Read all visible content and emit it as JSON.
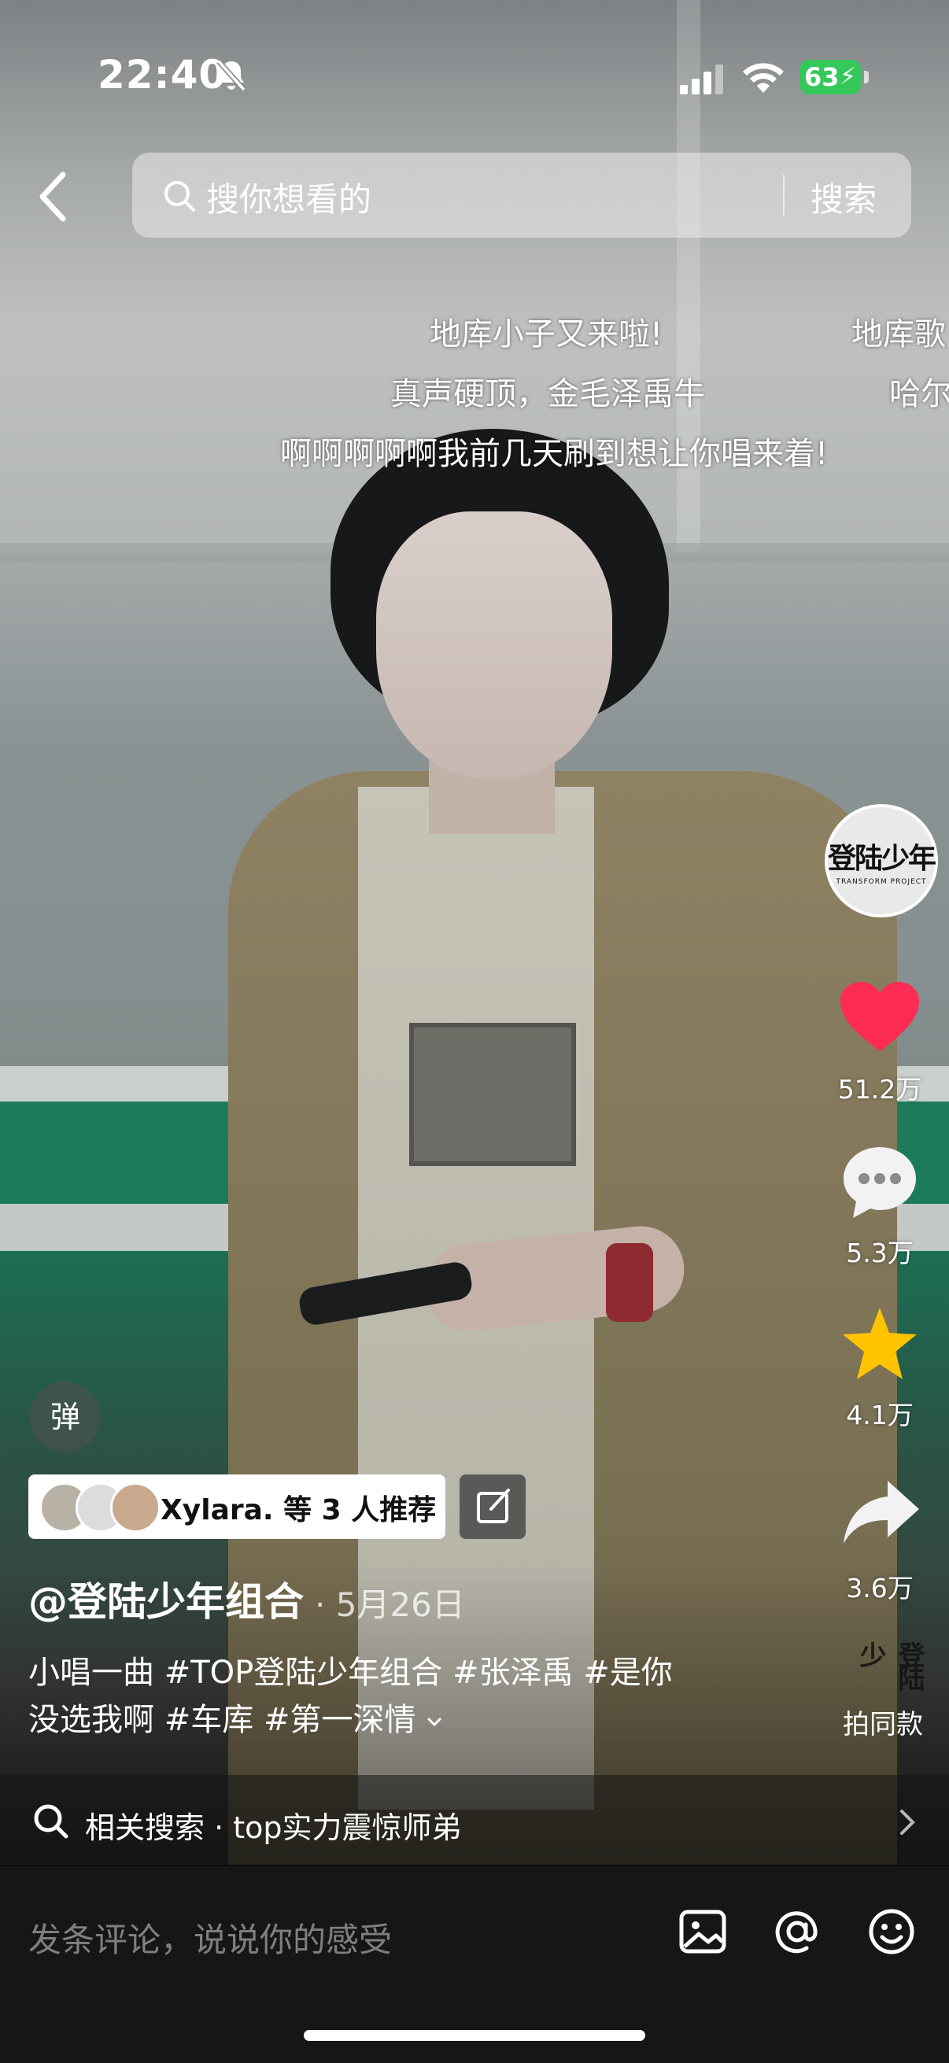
{
  "status_bar": {
    "time": "22:40",
    "battery": "63"
  },
  "search": {
    "placeholder": "搜你想看的",
    "button": "搜索"
  },
  "danmaku": [
    "地库小子又来啦!",
    "地库歌",
    "真声硬顶，金毛泽禹牛",
    "哈尔",
    "啊啊啊啊啊我前几天刷到想让你唱来着!"
  ],
  "creator_avatar": {
    "text": "登陆少年",
    "subtext": "TRANSFORM PROJECT"
  },
  "actions": {
    "like_count": "51.2万",
    "comment_count": "5.3万",
    "favorite_count": "4.1万",
    "share_count": "3.6万",
    "same_style_label": "拍同款"
  },
  "danmu_toggle": "弹",
  "recommend": {
    "text": "Xylara. 等 3 人推荐"
  },
  "post": {
    "author": "@登陆少年组合",
    "date": "· 5月26日",
    "caption_line1": "小唱一曲 #TOP登陆少年组合 #张泽禹 #是你",
    "caption_line2": "没选我啊 #车库 #第一深情"
  },
  "related": {
    "text": "相关搜索 · top实力震惊师弟"
  },
  "comment": {
    "placeholder": "发条评论，说说你的感受"
  },
  "colors": {
    "like": "#fe2c55",
    "favorite": "#ffc300",
    "battery": "#34c759"
  }
}
